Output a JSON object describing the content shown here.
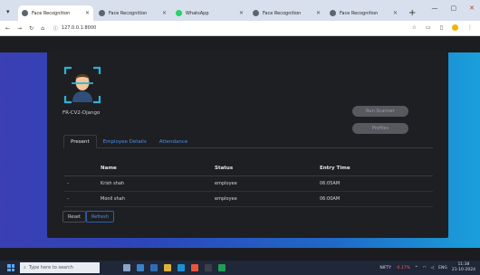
{
  "browser": {
    "tabs": [
      {
        "label": "Face Recognition",
        "active": true,
        "icon": "globe-icon"
      },
      {
        "label": "Face Recognition",
        "active": false,
        "icon": "globe-icon"
      },
      {
        "label": "WhatsApp",
        "active": false,
        "icon": "whatsapp-icon"
      },
      {
        "label": "Face Recognition",
        "active": false,
        "icon": "globe-icon"
      },
      {
        "label": "Face Recognition",
        "active": false,
        "icon": "globe-icon"
      }
    ],
    "url": "127.0.0.1:8000"
  },
  "app": {
    "title": "FR-CV2-Django",
    "buttons": {
      "run_scanner": "Run Scanner",
      "profiles": "Profiles"
    },
    "tabs": [
      {
        "label": "Present",
        "active": true
      },
      {
        "label": "Employee Details",
        "active": false
      },
      {
        "label": "Attendance",
        "active": false
      }
    ],
    "table": {
      "headers": [
        "",
        "Name",
        "Status",
        "Entry Time"
      ],
      "rows": [
        {
          "bullet": "-",
          "name": "Krish shah",
          "status": "employee",
          "entry_time": "06:05AM"
        },
        {
          "bullet": "-",
          "name": "Monil shah",
          "status": "employee",
          "entry_time": "06:00AM"
        }
      ]
    },
    "actions": {
      "reset": "Reset",
      "refresh": "Refresh"
    }
  },
  "taskbar": {
    "search_placeholder": "Type here to search",
    "stock_name": "NIFTY",
    "stock_change": "-0.17%",
    "language": "ENG",
    "time": "11:38",
    "date": "21-10-2024"
  },
  "colors": {
    "accent_blue": "#4f8fe8",
    "panel": "#1e1f22",
    "gradient_start": "#3a3fb3",
    "gradient_end": "#1aa0da"
  }
}
